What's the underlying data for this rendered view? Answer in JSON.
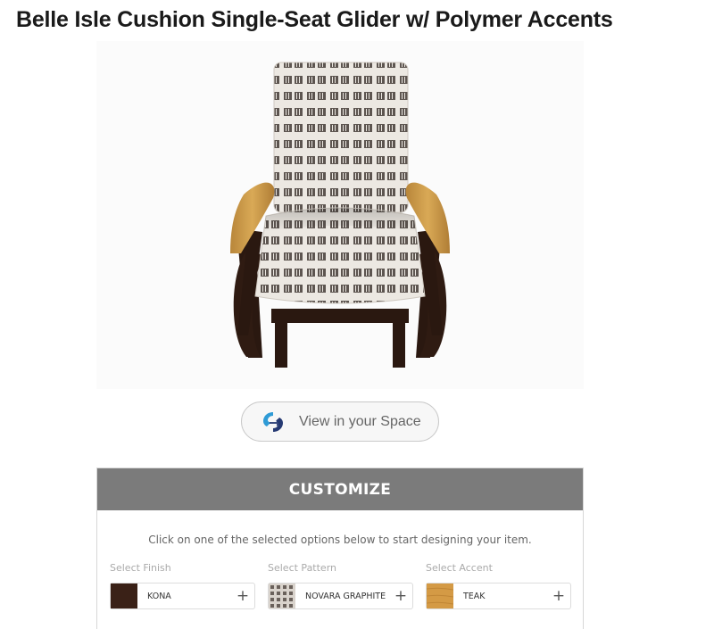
{
  "product": {
    "title": "Belle Isle Cushion Single-Seat Glider w/ Polymer Accents"
  },
  "ar_button": {
    "label": "View in your Space",
    "icon": "augmented-reality-icon"
  },
  "customize": {
    "header": "CUSTOMIZE",
    "instructions": "Click on one of the selected options below to start designing your item.",
    "options": [
      {
        "label": "Select Finish",
        "value": "KONA",
        "swatch_color": "#3a2117",
        "swatch_type": "solid"
      },
      {
        "label": "Select Pattern",
        "value": "NOVARA GRAPHITE",
        "swatch_color": "#8a817a",
        "swatch_type": "pattern"
      },
      {
        "label": "Select Accent",
        "value": "TEAK",
        "swatch_color": "#d49a45",
        "swatch_type": "solid"
      }
    ],
    "add_glyph": "+"
  },
  "colors": {
    "header_bg": "#7b7b7b",
    "frame": "#2a1810",
    "armrest": "#c99a4c",
    "fabric_base": "#ece8e2",
    "fabric_pattern": "#5a524d"
  }
}
